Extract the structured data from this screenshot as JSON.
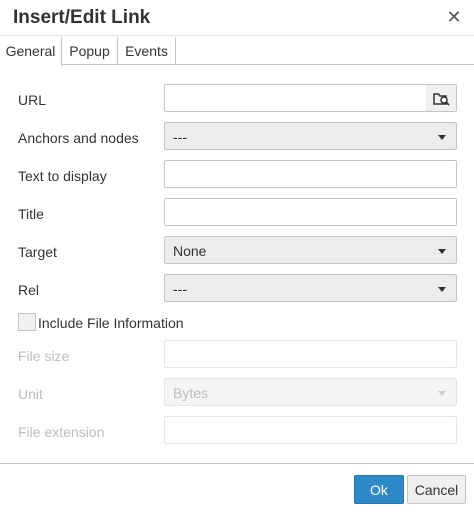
{
  "dialog": {
    "title": "Insert/Edit Link"
  },
  "tabs": [
    {
      "label": "General",
      "active": true
    },
    {
      "label": "Popup",
      "active": false
    },
    {
      "label": "Events",
      "active": false
    }
  ],
  "form": {
    "url": {
      "label": "URL",
      "value": ""
    },
    "anchors": {
      "label": "Anchors and nodes",
      "value": "---"
    },
    "text_to_display": {
      "label": "Text to display",
      "value": ""
    },
    "title": {
      "label": "Title",
      "value": ""
    },
    "target": {
      "label": "Target",
      "value": "None"
    },
    "rel": {
      "label": "Rel",
      "value": "---"
    },
    "include_file_info": {
      "label": "Include File Information",
      "checked": false
    },
    "file_size": {
      "label": "File size",
      "value": ""
    },
    "unit": {
      "label": "Unit",
      "value": "Bytes"
    },
    "file_extension": {
      "label": "File extension",
      "value": ""
    }
  },
  "footer": {
    "ok_label": "Ok",
    "cancel_label": "Cancel"
  },
  "icons": {
    "close": "close-icon",
    "browse": "folder-search-icon"
  },
  "colors": {
    "primary": "#2d8ac7",
    "disabled_text": "#bdbdbd"
  }
}
